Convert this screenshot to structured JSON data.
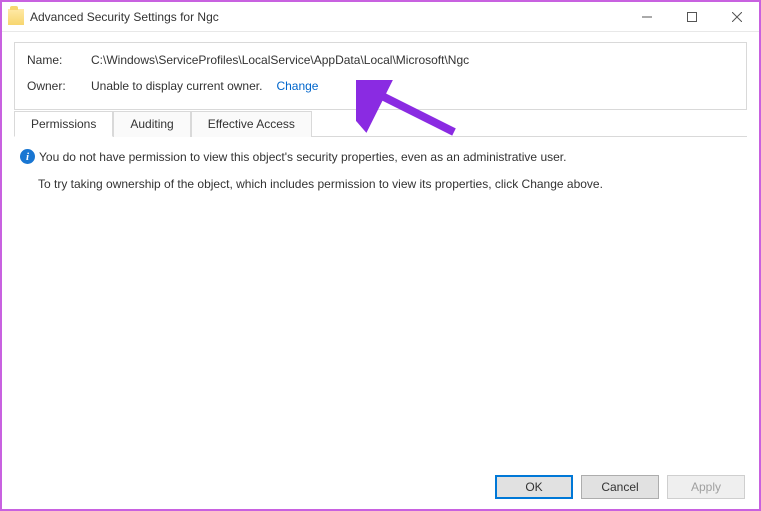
{
  "window": {
    "title": "Advanced Security Settings for Ngc"
  },
  "fields": {
    "name_label": "Name:",
    "name_value": "C:\\Windows\\ServiceProfiles\\LocalService\\AppData\\Local\\Microsoft\\Ngc",
    "owner_label": "Owner:",
    "owner_value": "Unable to display current owner.",
    "change_link": "Change"
  },
  "tabs": {
    "permissions": "Permissions",
    "auditing": "Auditing",
    "effective": "Effective Access"
  },
  "message": {
    "line1": "You do not have permission to view this object's security properties, even as an administrative user.",
    "line2": "To try taking ownership of the object, which includes permission to view its properties, click Change above."
  },
  "buttons": {
    "ok": "OK",
    "cancel": "Cancel",
    "apply": "Apply"
  },
  "annotation": {
    "arrow_color": "#8a2be2"
  }
}
